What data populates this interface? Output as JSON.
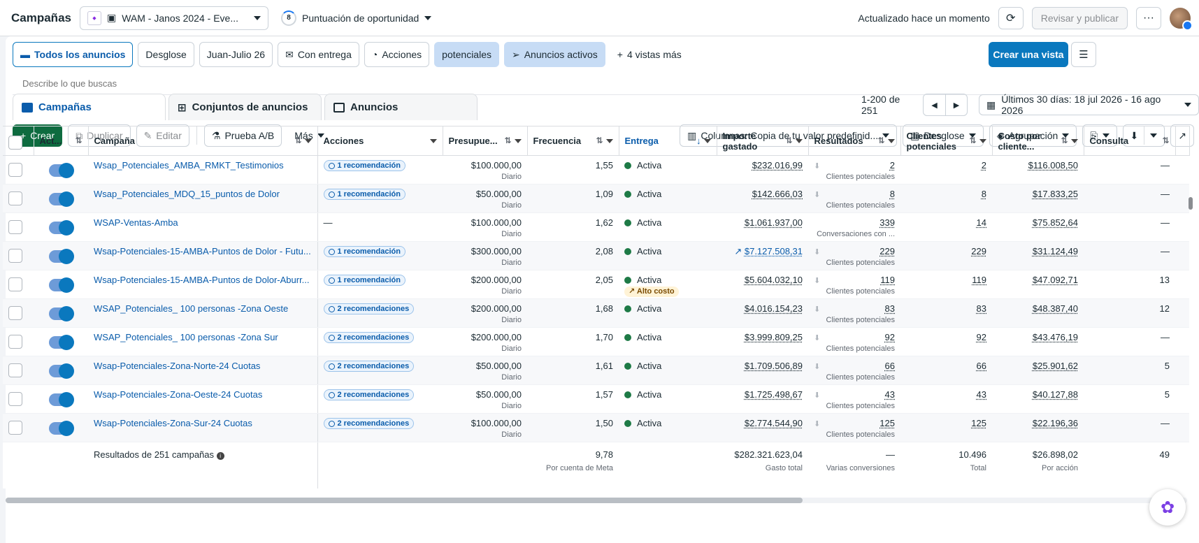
{
  "topbar": {
    "title": "Campañas",
    "account": "WAM - Janos 2024 - Eve...",
    "opportunity_score": "8",
    "opportunity_label": "Puntuación de oportunidad",
    "updated": "Actualizado hace un momento",
    "review_publish": "Revisar y publicar",
    "more": "···"
  },
  "views": {
    "all_ads": "Todos los anuncios",
    "breakdown": "Desglose",
    "date": "Juan-Julio 26",
    "with_delivery": "Con entrega",
    "actions": "Acciones",
    "potential": "potenciales",
    "active_ads": "Anuncios activos",
    "more_views": "4 vistas más",
    "create_view": "Crear una vista"
  },
  "search": {
    "placeholder": "Describe lo que buscas"
  },
  "tabs": {
    "campaigns": "Campañas",
    "adsets": "Conjuntos de anuncios",
    "ads": "Anuncios"
  },
  "pager": {
    "range": "1-200 de 251",
    "date_range": "Últimos 30 días: 18 jul 2026 - 16 ago 2026"
  },
  "toolbar": {
    "create": "Crear",
    "duplicate": "Duplicar",
    "edit": "Editar",
    "ab_test": "Prueba A/B",
    "more": "Más",
    "columns": "Columnas: Copia de tu valor predefinid...",
    "breakdown": "Desglose",
    "grouping": "Agrupación"
  },
  "headers": {
    "act": "Act...",
    "campaign": "Campaña",
    "actions": "Acciones",
    "budget": "Presupue...",
    "frequency": "Frecuencia",
    "delivery": "Entrega",
    "spent_1": "Importe",
    "spent_2": "gastado",
    "results": "Resultados",
    "leads_1": "Clientes",
    "leads_2": "potenciales",
    "cpl_1": "Costo por",
    "cpl_2": "cliente...",
    "consult": "Consulta"
  },
  "rows": [
    {
      "name": "Wsap_Potenciales_AMBA_RMKT_Testimonios",
      "rec": "1 recomendación",
      "budget": "$100.000,00",
      "budget_sub": "Diario",
      "freq": "1,55",
      "delivery": "Activa",
      "spent": "$232.016,99",
      "results": "2",
      "results_sub": "Clientes potenciales",
      "leads": "2",
      "cpl": "$116.008,50",
      "consult": "—"
    },
    {
      "name": "Wsap_Potenciales_MDQ_15_puntos de Dolor",
      "rec": "1 recomendación",
      "budget": "$50.000,00",
      "budget_sub": "Diario",
      "freq": "1,09",
      "delivery": "Activa",
      "spent": "$142.666,03",
      "results": "8",
      "results_sub": "Clientes potenciales",
      "leads": "8",
      "cpl": "$17.833,25",
      "consult": "—"
    },
    {
      "name": "WSAP-Ventas-Amba",
      "rec": "",
      "rec_dash": "—",
      "budget": "$100.000,00",
      "budget_sub": "Diario",
      "freq": "1,62",
      "delivery": "Activa",
      "spent": "$1.061.937,00",
      "results": "339",
      "results_sub": "Conversaciones con ...",
      "leads": "14",
      "cpl": "$75.852,64",
      "consult": "—"
    },
    {
      "name": "Wsap-Potenciales-15-AMBA-Puntos de Dolor - Futu...",
      "rec": "1 recomendación",
      "budget": "$300.000,00",
      "budget_sub": "Diario",
      "freq": "2,08",
      "delivery": "Activa",
      "spent": "$7.127.508,31",
      "spent_trend": true,
      "results": "229",
      "results_sub": "Clientes potenciales",
      "leads": "229",
      "cpl": "$31.124,49",
      "consult": "—"
    },
    {
      "name": "Wsap-Potenciales-15-AMBA-Puntos de Dolor-Aburr...",
      "rec": "1 recomendación",
      "budget": "$200.000,00",
      "budget_sub": "Diario",
      "freq": "2,05",
      "delivery": "Activa",
      "high_cost": "Alto costo",
      "spent": "$5.604.032,10",
      "results": "119",
      "results_sub": "Clientes potenciales",
      "leads": "119",
      "cpl": "$47.092,71",
      "consult": "13"
    },
    {
      "name": "WSAP_Potenciales_ 100 personas -Zona Oeste",
      "rec": "2 recomendaciones",
      "budget": "$200.000,00",
      "budget_sub": "Diario",
      "freq": "1,68",
      "delivery": "Activa",
      "spent": "$4.016.154,23",
      "results": "83",
      "results_sub": "Clientes potenciales",
      "leads": "83",
      "cpl": "$48.387,40",
      "consult": "12"
    },
    {
      "name": "WSAP_Potenciales_ 100 personas -Zona Sur",
      "rec": "2 recomendaciones",
      "budget": "$200.000,00",
      "budget_sub": "Diario",
      "freq": "1,70",
      "delivery": "Activa",
      "spent": "$3.999.809,25",
      "results": "92",
      "results_sub": "Clientes potenciales",
      "leads": "92",
      "cpl": "$43.476,19",
      "consult": "—"
    },
    {
      "name": "Wsap-Potenciales-Zona-Norte-24 Cuotas",
      "rec": "2 recomendaciones",
      "budget": "$50.000,00",
      "budget_sub": "Diario",
      "freq": "1,61",
      "delivery": "Activa",
      "spent": "$1.709.506,89",
      "results": "66",
      "results_sub": "Clientes potenciales",
      "leads": "66",
      "cpl": "$25.901,62",
      "consult": "5"
    },
    {
      "name": "Wsap-Potenciales-Zona-Oeste-24 Cuotas",
      "rec": "2 recomendaciones",
      "budget": "$50.000,00",
      "budget_sub": "Diario",
      "freq": "1,57",
      "delivery": "Activa",
      "spent": "$1.725.498,67",
      "results": "43",
      "results_sub": "Clientes potenciales",
      "leads": "43",
      "cpl": "$40.127,88",
      "consult": "5"
    },
    {
      "name": "Wsap-Potenciales-Zona-Sur-24 Cuotas",
      "rec": "2 recomendaciones",
      "budget": "$100.000,00",
      "budget_sub": "Diario",
      "freq": "1,50",
      "delivery": "Activa",
      "spent": "$2.774.544,90",
      "results": "125",
      "results_sub": "Clientes potenciales",
      "leads": "125",
      "cpl": "$22.196,36",
      "consult": "—"
    }
  ],
  "summary": {
    "label": "Resultados de 251 campañas",
    "freq": "9,78",
    "freq_sub": "Por cuenta de Meta",
    "spent": "$282.321.623,04",
    "spent_sub": "Gasto total",
    "results": "—",
    "results_sub": "Varias conversiones",
    "leads": "10.496",
    "leads_sub": "Total",
    "cpl": "$26.898,02",
    "cpl_sub": "Por acción",
    "consult": "49"
  },
  "colors": {
    "accent": "#0a78be",
    "create": "#0e6b3f",
    "active_dot": "#1e7a46"
  }
}
